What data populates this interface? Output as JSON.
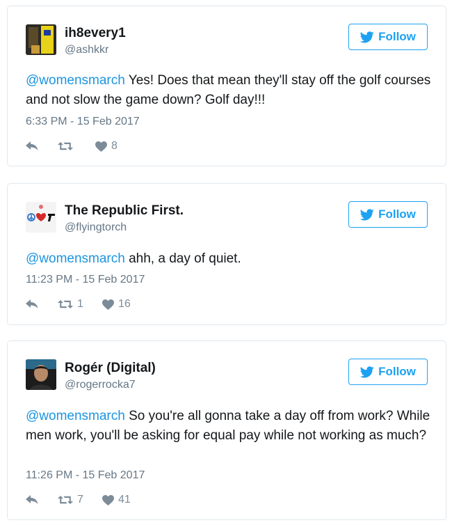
{
  "colors": {
    "accent": "#1da1f2",
    "mention": "#1b95e0",
    "meta": "#657786",
    "border": "#e1e8ed"
  },
  "tweets": [
    {
      "name": "ih8every1",
      "handle": "@ashkkr",
      "follow_label": "Follow",
      "mention": "@womensmarch",
      "body": " Yes! Does that mean they'll stay off the golf courses and not slow the game down? Golf day!!!",
      "time": "6:33 PM - 15 Feb 2017",
      "retweets": "",
      "likes": "8",
      "avatar_icon": "toy-figure-avatar"
    },
    {
      "name": "The Republic First.",
      "handle": "@flyingtorch",
      "follow_label": "Follow",
      "mention": "@womensmarch",
      "body": " ahh, a day of quiet.",
      "time": "11:23 PM - 15 Feb 2017",
      "retweets": "1",
      "likes": "16",
      "avatar_icon": "peace-heart-gun-avatar"
    },
    {
      "name": "Rogér (Digital)",
      "handle": "@rogerrocka7",
      "follow_label": "Follow",
      "mention": "@womensmarch",
      "body": " So you're all gonna take a day off from work? While men work, you'll be asking for equal pay while not working as much?",
      "time": "11:26 PM - 15 Feb 2017",
      "retweets": "7",
      "likes": "41",
      "avatar_icon": "man-portrait-avatar"
    }
  ]
}
